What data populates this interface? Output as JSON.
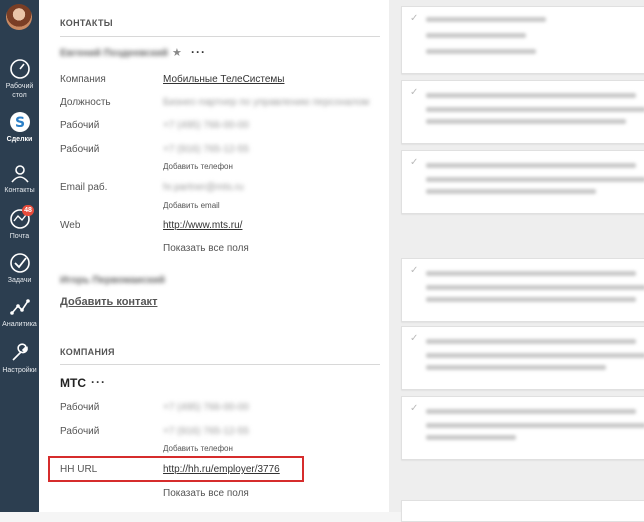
{
  "nav": {
    "items": [
      {
        "label": "Рабочий стол",
        "icon": "dashboard-icon"
      },
      {
        "label": "Сделки",
        "icon": "deals-icon"
      },
      {
        "label": "Контакты",
        "icon": "contacts-icon"
      },
      {
        "label": "Почта",
        "icon": "mail-icon",
        "badge": "48"
      },
      {
        "label": "Задачи",
        "icon": "tasks-icon"
      },
      {
        "label": "Аналитика",
        "icon": "analytics-icon"
      },
      {
        "label": "Настройки",
        "icon": "settings-icon"
      }
    ]
  },
  "contacts": {
    "section_title": "КОНТАКТЫ",
    "primary_contact": {
      "name": "Евгений Поздеевский",
      "fields": {
        "company_label": "Компания",
        "company_value": "Мобильные ТелеСистемы",
        "position_label": "Должность",
        "position_value": "Бизнес-партнер по управлению персоналом",
        "work1_label": "Рабочий",
        "work1_value": "+7 (495) 766-00-00",
        "work2_label": "Рабочий",
        "work2_value": "+7 (916) 765-12-55",
        "add_phone": "Добавить телефон",
        "email_label": "Email раб.",
        "email_value": "hr.partner@mts.ru",
        "add_email": "Добавить email",
        "web_label": "Web",
        "web_value": "http://www.mts.ru/",
        "show_all": "Показать все поля"
      }
    },
    "secondary_contact_name": "Игорь Первомаиский",
    "add_contact": "Добавить контакт"
  },
  "company": {
    "section_title": "КОМПАНИЯ",
    "name": "МТС",
    "work1_label": "Рабочий",
    "work1_value": "+7 (495) 766-00-00",
    "work2_label": "Рабочий",
    "work2_value": "+7 (916) 765-12-55",
    "add_phone": "Добавить телефон",
    "hh_label": "HH URL",
    "hh_value": "http://hh.ru/employer/3776",
    "show_all": "Показать все поля"
  },
  "colors": {
    "sidebar": "#2c3e50",
    "highlight": "#d62c2c",
    "badge": "#e74c3c"
  }
}
